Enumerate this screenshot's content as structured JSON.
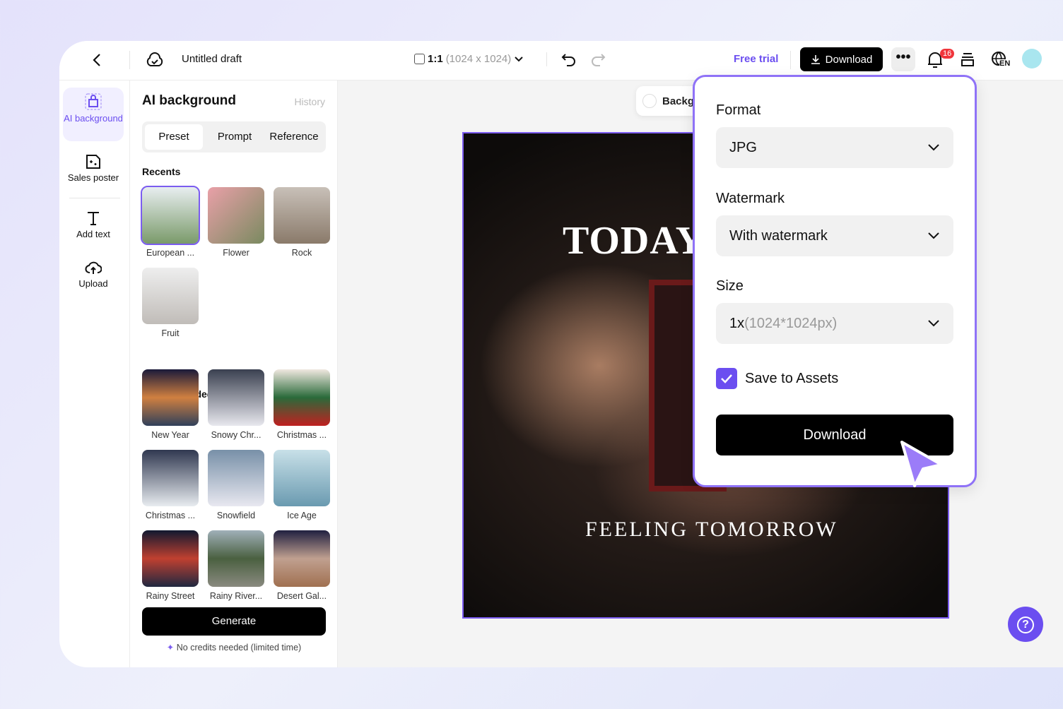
{
  "topbar": {
    "doc_title": "Untitled draft",
    "ratio": "1:1",
    "ratio_size": "(1024 x 1024)",
    "free_trial": "Free trial",
    "download": "Download",
    "notifications": "16",
    "lang": "EN"
  },
  "rail": [
    {
      "label": "AI background",
      "active": true
    },
    {
      "label": "Sales poster"
    },
    {
      "label": "Add text"
    },
    {
      "label": "Upload"
    }
  ],
  "panel": {
    "title": "AI background",
    "history": "History",
    "tabs": [
      "Preset",
      "Prompt",
      "Reference"
    ],
    "active_tab": "Preset",
    "recents_title": "Recents",
    "recents": [
      "European ...",
      "Flower",
      "Rock",
      "Fruit"
    ],
    "recommended_title": "Recommended",
    "recommended": [
      "New Year",
      "Snowy Chr...",
      "Christmas ...",
      "Christmas ...",
      "Snowfield",
      "Ice Age",
      "Rainy Street",
      "Rainy River...",
      "Desert Gal..."
    ],
    "generate": "Generate",
    "note": "No credits needed (limited time)"
  },
  "canvas": {
    "bg_chip": "Backgr",
    "headline": "TODAY",
    "subline": "FEELING TOMORROW"
  },
  "popup": {
    "format_label": "Format",
    "format": "JPG",
    "watermark_label": "Watermark",
    "watermark": "With watermark",
    "size_label": "Size",
    "size_main": "1x",
    "size_detail": "(1024*1024px)",
    "save_label": "Save to Assets",
    "save_checked": true,
    "download": "Download"
  },
  "colors": {
    "accent": "#7b5cf0",
    "badge": "#f0353b"
  }
}
